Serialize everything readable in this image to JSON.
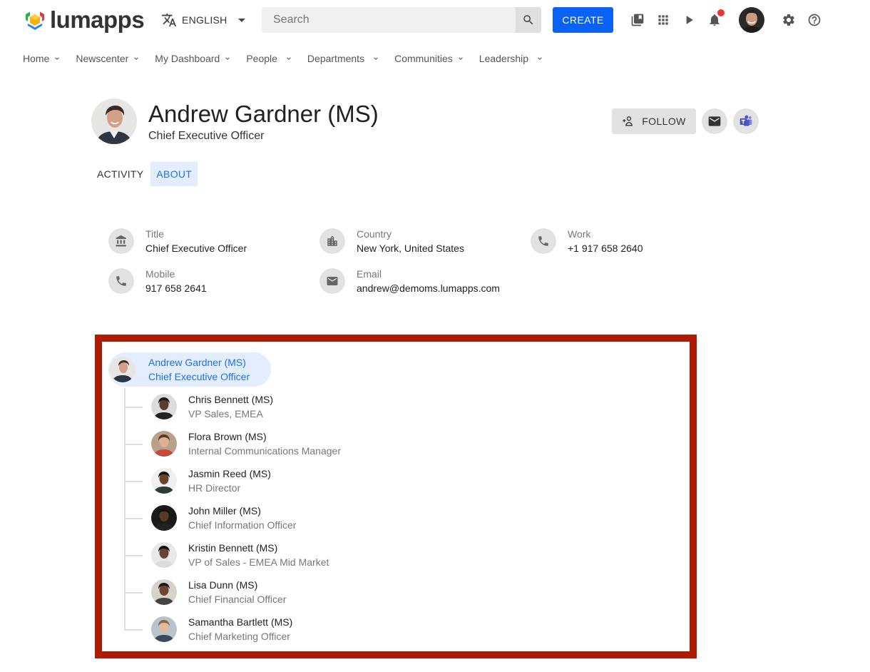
{
  "app": {
    "brand": "lumapps",
    "language": "ENGLISH",
    "search_placeholder": "Search",
    "create_label": "CREATE",
    "notifications_unread": true,
    "accent_color": "#0961f6",
    "highlight_color": "#b01a00"
  },
  "topbar_icons": [
    "bookmarks-icon",
    "apps-grid-icon",
    "play-icon",
    "notifications-icon",
    "user-avatar",
    "settings-icon",
    "help-icon"
  ],
  "nav": {
    "items": [
      {
        "label": "Home"
      },
      {
        "label": "Newscenter"
      },
      {
        "label": "My Dashboard"
      },
      {
        "label": "People"
      },
      {
        "label": "Departments"
      },
      {
        "label": "Communities"
      },
      {
        "label": "Leadership"
      }
    ]
  },
  "profile": {
    "name": "Andrew Gardner (MS)",
    "role": "Chief Executive Officer",
    "follow_label": "FOLLOW",
    "tabs": [
      {
        "label": "ACTIVITY",
        "active": false
      },
      {
        "label": "ABOUT",
        "active": true
      }
    ]
  },
  "about": {
    "fields": [
      {
        "label": "Title",
        "value": "Chief Executive Officer",
        "icon": "bank-icon"
      },
      {
        "label": "Country",
        "value": "New York, United States",
        "icon": "city-icon"
      },
      {
        "label": "Work",
        "value": "+1 917 658 2640",
        "icon": "phone-icon"
      },
      {
        "label": "Mobile",
        "value": "917 658 2641",
        "icon": "phone-icon"
      },
      {
        "label": "Email",
        "value": "andrew@demoms.lumapps.com",
        "icon": "email-icon"
      }
    ]
  },
  "org_chart": {
    "root": {
      "name": "Andrew Gardner (MS)",
      "role": "Chief Executive Officer"
    },
    "reports": [
      {
        "name": "Chris Bennett (MS)",
        "role": "VP Sales, EMEA"
      },
      {
        "name": "Flora Brown (MS)",
        "role": "Internal Communications Manager"
      },
      {
        "name": "Jasmin Reed (MS)",
        "role": "HR Director"
      },
      {
        "name": "John Miller (MS)",
        "role": "Chief Information Officer"
      },
      {
        "name": "Kristin Bennett (MS)",
        "role": "VP of Sales - EMEA Mid Market"
      },
      {
        "name": "Lisa Dunn (MS)",
        "role": "Chief Financial Officer"
      },
      {
        "name": "Samantha Bartlett (MS)",
        "role": "Chief Marketing Officer"
      }
    ]
  }
}
